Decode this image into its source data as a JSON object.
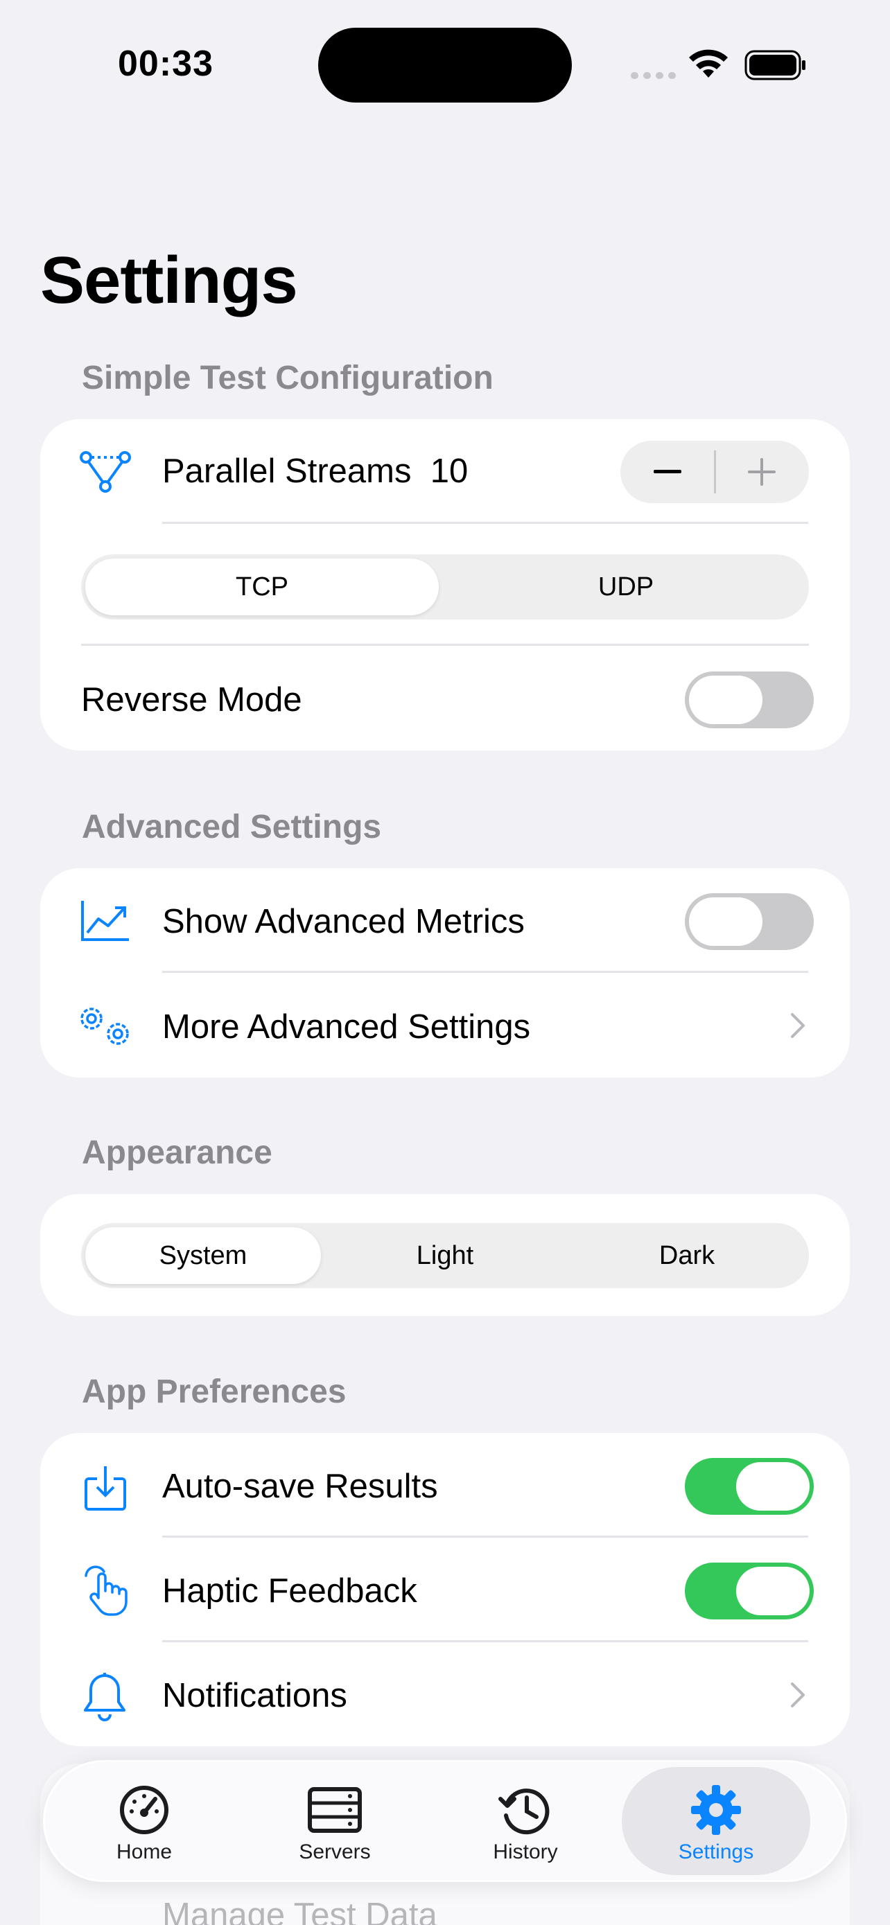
{
  "status_bar": {
    "time": "00:33"
  },
  "page_title": "Settings",
  "sections": {
    "simple": {
      "header": "Simple Test Configuration",
      "parallel_streams_label": "Parallel Streams",
      "parallel_streams_value": "10",
      "protocol_options": [
        "TCP",
        "UDP"
      ],
      "protocol_selected": "TCP",
      "reverse_mode_label": "Reverse Mode",
      "reverse_mode_on": false
    },
    "advanced": {
      "header": "Advanced Settings",
      "show_metrics_label": "Show Advanced Metrics",
      "show_metrics_on": false,
      "more_settings_label": "More Advanced Settings"
    },
    "appearance": {
      "header": "Appearance",
      "options": [
        "System",
        "Light",
        "Dark"
      ],
      "selected": "System"
    },
    "preferences": {
      "header": "App Preferences",
      "autosave_label": "Auto-save Results",
      "autosave_on": true,
      "haptic_label": "Haptic Feedback",
      "haptic_on": true,
      "notifications_label": "Notifications"
    },
    "peek": {
      "manage_label": "Manage Test Data"
    }
  },
  "tabbar": {
    "items": [
      {
        "label": "Home",
        "icon": "speedometer-icon"
      },
      {
        "label": "Servers",
        "icon": "server-rack-icon"
      },
      {
        "label": "History",
        "icon": "clock-history-icon"
      },
      {
        "label": "Settings",
        "icon": "gear-icon"
      }
    ],
    "active": "Settings"
  },
  "colors": {
    "accent": "#0A84FF",
    "toggle_on": "#34C759",
    "toggle_off": "#CACACC",
    "background": "#F1F1F6",
    "section_header": "#8A8A8E"
  }
}
